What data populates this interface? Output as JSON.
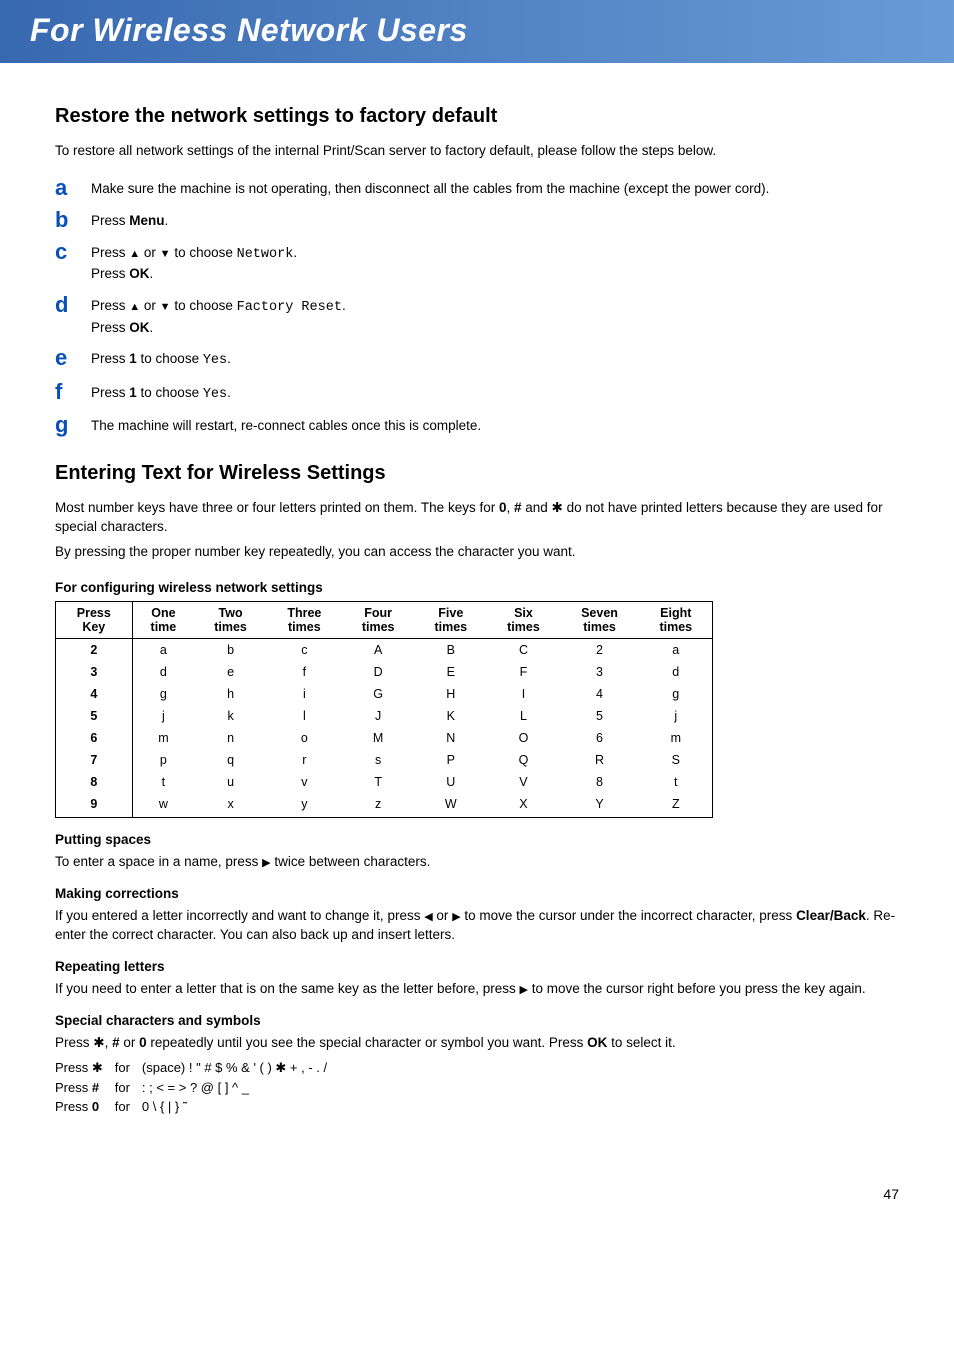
{
  "header": {
    "title": "For Wireless Network Users"
  },
  "section_restore": {
    "heading": "Restore the network settings to factory default",
    "intro": "To restore all network settings of the internal Print/Scan server to factory default, please follow the steps below.",
    "steps": {
      "a": {
        "letter": "a",
        "text": "Make sure the machine is not operating, then disconnect all the cables from the machine (except the power cord)."
      },
      "b": {
        "letter": "b",
        "prefix": "Press ",
        "bold": "Menu",
        "suffix": "."
      },
      "c": {
        "letter": "c",
        "l1a": "Press ",
        "l1b": " or ",
        "l1c": " to choose ",
        "mono": "Network",
        "l1d": ".",
        "l2a": "Press ",
        "l2bold": "OK",
        "l2b": "."
      },
      "d": {
        "letter": "d",
        "l1a": "Press ",
        "l1b": " or ",
        "l1c": " to choose ",
        "mono": "Factory Reset",
        "l1d": ".",
        "l2a": "Press ",
        "l2bold": "OK",
        "l2b": "."
      },
      "e": {
        "letter": "e",
        "l1a": "Press ",
        "l1bold": "1",
        "l1b": " to choose ",
        "mono": "Yes",
        "l1c": "."
      },
      "f": {
        "letter": "f",
        "l1a": "Press ",
        "l1bold": "1",
        "l1b": "  to choose ",
        "mono": "Yes",
        "l1c": "."
      },
      "g": {
        "letter": "g",
        "text": "The machine will restart, re-connect cables once this is complete."
      }
    }
  },
  "section_entering": {
    "heading": "Entering Text for Wireless Settings",
    "para1a": "Most number keys have three or four letters printed on them. The keys for ",
    "para1b": ", ",
    "para1c": " and ",
    "para1d": " do not have printed letters because they are used for special characters.",
    "para1_bold0": "0",
    "para1_boldhash": "#",
    "para1_star": "l",
    "para2": "By pressing the proper number key repeatedly, you can access the character you want.",
    "table_caption": "For configuring wireless network settings",
    "headers": [
      "Press Key",
      "One time",
      "Two times",
      "Three times",
      "Four times",
      "Five times",
      "Six times",
      "Seven times",
      "Eight times"
    ],
    "rows": [
      [
        "2",
        "a",
        "b",
        "c",
        "A",
        "B",
        "C",
        "2",
        "a"
      ],
      [
        "3",
        "d",
        "e",
        "f",
        "D",
        "E",
        "F",
        "3",
        "d"
      ],
      [
        "4",
        "g",
        "h",
        "i",
        "G",
        "H",
        "I",
        "4",
        "g"
      ],
      [
        "5",
        "j",
        "k",
        "l",
        "J",
        "K",
        "L",
        "5",
        "j"
      ],
      [
        "6",
        "m",
        "n",
        "o",
        "M",
        "N",
        "O",
        "6",
        "m"
      ],
      [
        "7",
        "p",
        "q",
        "r",
        "s",
        "P",
        "Q",
        "R",
        "S"
      ],
      [
        "8",
        "t",
        "u",
        "v",
        "T",
        "U",
        "V",
        "8",
        "t"
      ],
      [
        "9",
        "w",
        "x",
        "y",
        "z",
        "W",
        "X",
        "Y",
        "Z"
      ]
    ],
    "putting_spaces": {
      "head": "Putting spaces",
      "a": "To enter a space in a name, press ",
      "b": " twice between characters."
    },
    "making_corrections": {
      "head": "Making corrections",
      "a": "If you entered a letter incorrectly and want to change it, press ",
      "b": " or ",
      "c": " to move the cursor under the incorrect character, press ",
      "bold": "Clear/Back",
      "d": ". Re-enter the correct character. You can also back up and insert letters."
    },
    "repeating_letters": {
      "head": "Repeating letters",
      "a": "If you need to enter a letter that is on the same key as the letter before, press ",
      "b": " to move the cursor right before you press the key again."
    },
    "special": {
      "head": "Special characters and symbols",
      "line_a": "Press ",
      "line_star": "l",
      "line_b": ", ",
      "line_hash": "#",
      "line_c": " or ",
      "line_zero": "0",
      "line_d": " repeatedly until you see the special character or symbol you want. Press ",
      "line_ok": "OK",
      "line_e": " to select it.",
      "rows": [
        {
          "press": "Press ",
          "key": "l",
          "for": "for",
          "chars": "(space) ! \" # $ % & ' ( ) l + , - . /"
        },
        {
          "press": "Press ",
          "key": "#",
          "for": "for",
          "chars": ": ; < = > ? @ [ ] ^ _"
        },
        {
          "press": "Press ",
          "key": "0",
          "for": "for",
          "chars": "0 \\ { | } ˜"
        }
      ]
    }
  },
  "pagenum": "47",
  "glyph": {
    "up": "▲",
    "down": "▼",
    "left": "◀",
    "right": "▶",
    "star": "✱"
  }
}
